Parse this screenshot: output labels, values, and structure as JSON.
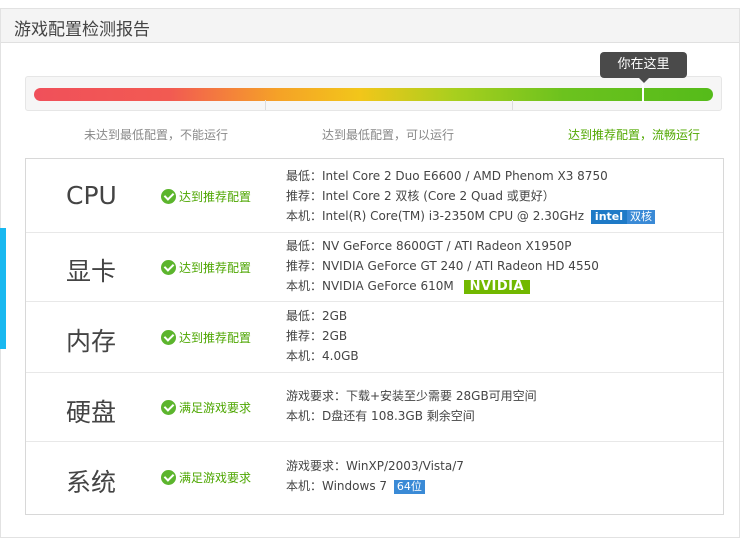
{
  "header": {
    "title": "游戏配置检测报告"
  },
  "progress": {
    "tooltip": "你在这里",
    "level_fraction": 0.95,
    "labels": {
      "below_min": "未达到最低配置，不能运行",
      "min": "达到最低配置，可以运行",
      "recommended": "达到推荐配置，流畅运行"
    }
  },
  "rows": [
    {
      "name": "CPU",
      "status": "达到推荐配置",
      "lines": [
        "最低：Intel Core 2 Duo E6600 / AMD Phenom X3 8750",
        "推荐：Intel Core 2 双核 (Core 2 Quad 或更好）",
        "本机：Intel(R) Core(TM) i3-2350M CPU @ 2.30GHz"
      ],
      "badges": [
        "intel",
        "双核"
      ]
    },
    {
      "name": "显卡",
      "status": "达到推荐配置",
      "lines": [
        "最低：NV GeForce 8600GT / ATI Radeon X1950P",
        "推荐：NVIDIA GeForce GT 240 / ATI Radeon HD 4550",
        "本机：NVIDIA GeForce 610M"
      ],
      "badges": [
        "NVIDIA"
      ]
    },
    {
      "name": "内存",
      "status": "达到推荐配置",
      "lines": [
        "最低：2GB",
        "推荐：2GB",
        "本机：4.0GB"
      ]
    },
    {
      "name": "硬盘",
      "status": "满足游戏要求",
      "lines": [
        "游戏要求：下载+安装至少需要 28GB可用空间",
        "本机：D盘还有 108.3GB 剩余空间"
      ]
    },
    {
      "name": "系统",
      "status": "满足游戏要求",
      "lines": [
        "游戏要求：WinXP/2003/Vista/7",
        "本机：Windows 7"
      ],
      "badges": [
        "64位"
      ]
    }
  ],
  "colors": {
    "accent": "#19b8f0",
    "ok_green": "#5cb52d",
    "bar_red": "#f0505a",
    "bar_yellow": "#f2c61a",
    "bar_green": "#55bb1a"
  },
  "icons": {
    "status": "check-circle-icon"
  }
}
